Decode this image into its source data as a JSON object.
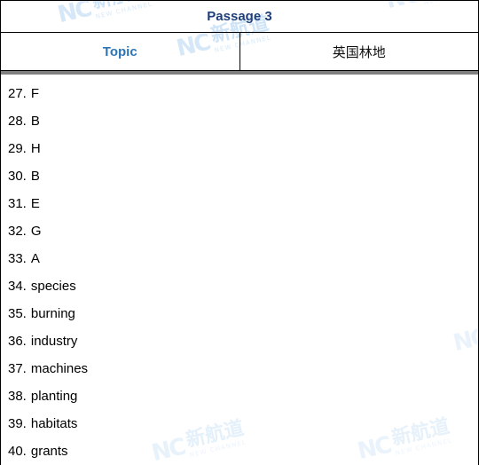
{
  "document": {
    "title": "Passage 3",
    "topic_label": "Topic",
    "topic_value": "英国林地"
  },
  "watermark": {
    "mark": "NC",
    "brand_cn": "新航道",
    "brand_en": "NEW CHANNEL"
  },
  "colors": {
    "title_blue": "#1f3f7a",
    "label_blue": "#2e75b6",
    "separator_gray": "#808080",
    "border_black": "#000000",
    "watermark_blue": "#d6e8f8"
  },
  "answers": [
    {
      "number": "27.",
      "value": "F"
    },
    {
      "number": "28.",
      "value": "B"
    },
    {
      "number": "29.",
      "value": "H"
    },
    {
      "number": "30.",
      "value": "B"
    },
    {
      "number": "31.",
      "value": "E"
    },
    {
      "number": "32.",
      "value": "G"
    },
    {
      "number": "33.",
      "value": "A"
    },
    {
      "number": "34.",
      "value": "species"
    },
    {
      "number": "35.",
      "value": "burning"
    },
    {
      "number": "36.",
      "value": "industry"
    },
    {
      "number": "37.",
      "value": "machines"
    },
    {
      "number": "38.",
      "value": "planting"
    },
    {
      "number": "39.",
      "value": "habitats"
    },
    {
      "number": "40.",
      "value": "grants"
    }
  ]
}
